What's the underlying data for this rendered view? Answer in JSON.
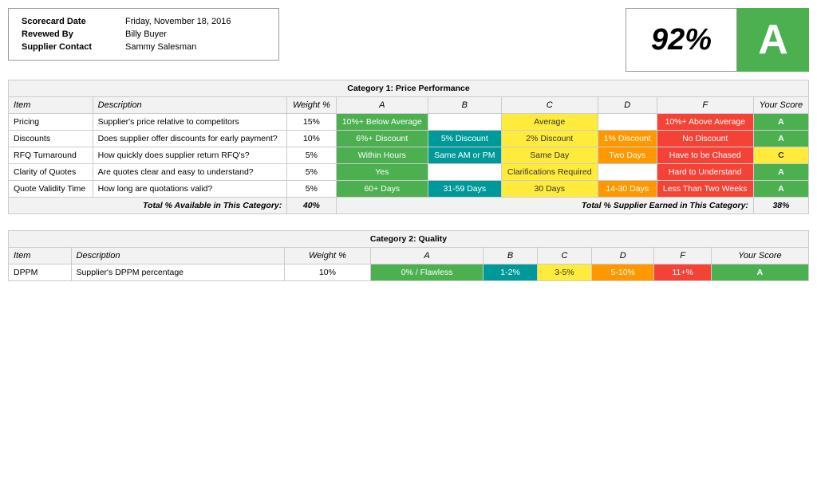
{
  "header": {
    "fields": [
      {
        "label": "Scorecard Date",
        "value": "Friday, November 18, 2016"
      },
      {
        "label": "Revewed By",
        "value": "Billy Buyer"
      },
      {
        "label": "Supplier Contact",
        "value": "Sammy Salesman"
      }
    ],
    "score_percent": "92%",
    "score_grade": "A"
  },
  "category1": {
    "title": "Category 1: Price Performance",
    "columns": {
      "item": "Item",
      "description": "Description",
      "weight": "Weight %",
      "a": "A",
      "b": "B",
      "c": "C",
      "d": "D",
      "f": "F",
      "your_score": "Your Score"
    },
    "rows": [
      {
        "item": "Pricing",
        "description": "Supplier's price relative to competitors",
        "weight": "15%",
        "a": "10%+ Below Average",
        "b": "",
        "c": "Average",
        "d": "",
        "f": "10%+ Above Average",
        "your_score": "A",
        "a_color": "cell-green",
        "b_color": "",
        "c_color": "cell-yellow",
        "d_color": "",
        "f_color": "cell-red",
        "score_color": "cell-score-green"
      },
      {
        "item": "Discounts",
        "description": "Does supplier offer discounts for early payment?",
        "weight": "10%",
        "a": "6%+ Discount",
        "b": "5% Discount",
        "c": "2% Discount",
        "d": "1% Discount",
        "f": "No Discount",
        "your_score": "A",
        "a_color": "cell-green",
        "b_color": "cell-teal",
        "c_color": "cell-yellow",
        "d_color": "cell-orange",
        "f_color": "cell-red",
        "score_color": "cell-score-green"
      },
      {
        "item": "RFQ Turnaround",
        "description": "How quickly does supplier return RFQ's?",
        "weight": "5%",
        "a": "Within Hours",
        "b": "Same AM or PM",
        "c": "Same Day",
        "d": "Two Days",
        "f": "Have to be Chased",
        "your_score": "C",
        "a_color": "cell-green",
        "b_color": "cell-teal",
        "c_color": "cell-yellow",
        "d_color": "cell-orange",
        "f_color": "cell-red",
        "score_color": "cell-score-yellow"
      },
      {
        "item": "Clarity of Quotes",
        "description": "Are quotes clear and easy to understand?",
        "weight": "5%",
        "a": "Yes",
        "b": "",
        "c": "Clarifications Required",
        "d": "",
        "f": "Hard to Understand",
        "your_score": "A",
        "a_color": "cell-green",
        "b_color": "",
        "c_color": "cell-yellow",
        "d_color": "",
        "f_color": "cell-red",
        "score_color": "cell-score-green"
      },
      {
        "item": "Quote Validity Time",
        "description": "How long are quotations valid?",
        "weight": "5%",
        "a": "60+ Days",
        "b": "31-59 Days",
        "c": "30 Days",
        "d": "14-30 Days",
        "f": "Less Than Two Weeks",
        "your_score": "A",
        "a_color": "cell-green",
        "b_color": "cell-teal",
        "c_color": "cell-yellow",
        "d_color": "cell-orange",
        "f_color": "cell-red",
        "score_color": "cell-score-green"
      }
    ],
    "total_available_label": "Total % Available in This Category:",
    "total_available_value": "40%",
    "total_earned_label": "Total % Supplier Earned in This Category:",
    "total_earned_value": "38%"
  },
  "category2": {
    "title": "Category 2: Quality",
    "columns": {
      "item": "Item",
      "description": "Description",
      "weight": "Weight %",
      "a": "A",
      "b": "B",
      "c": "C",
      "d": "D",
      "f": "F",
      "your_score": "Your Score"
    },
    "rows": [
      {
        "item": "DPPM",
        "description": "Supplier's DPPM percentage",
        "weight": "10%",
        "a": "0% / Flawless",
        "b": "1-2%",
        "c": "3-5%",
        "d": "5-10%",
        "f": "11+%",
        "your_score": "A",
        "a_color": "cell-green",
        "b_color": "cell-teal",
        "c_color": "cell-yellow",
        "d_color": "cell-orange",
        "f_color": "cell-red",
        "score_color": "cell-score-green"
      }
    ]
  }
}
